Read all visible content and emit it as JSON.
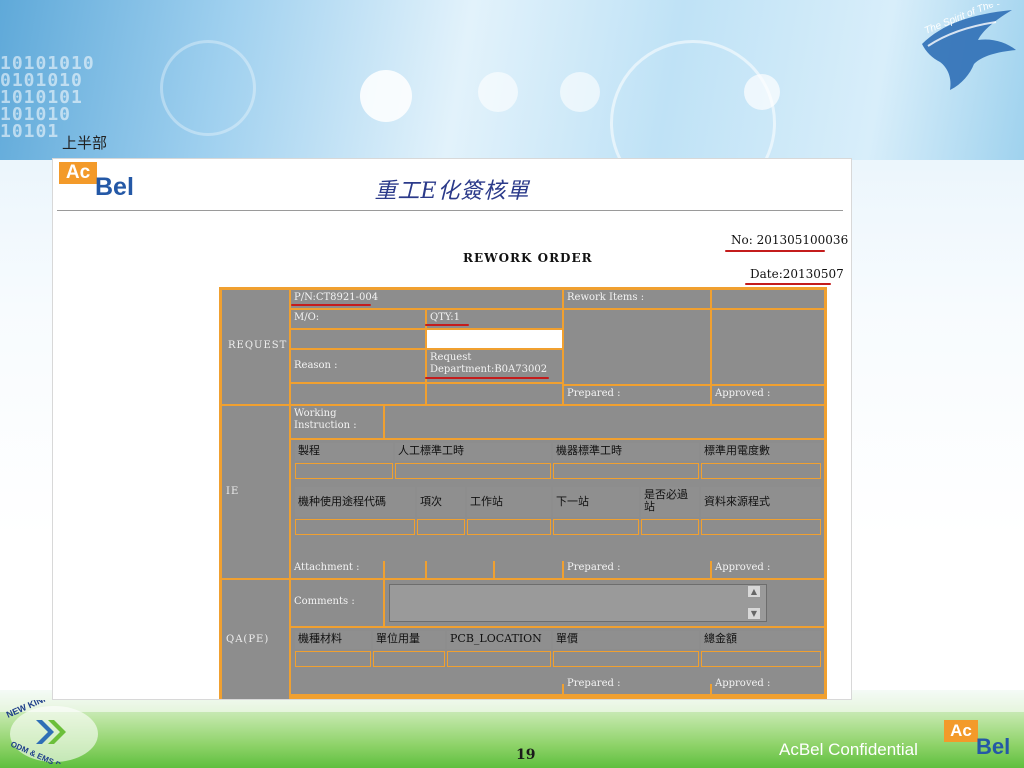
{
  "slide": {
    "caption": "上半部",
    "page_number": "19",
    "confidential": "AcBel Confidential",
    "eagle_tagline": "The Spirit of The Eagle",
    "partner_badge_top": "NEW KINPO VALUE",
    "partner_badge_bottom": "ODM & EMS Partner"
  },
  "logo": {
    "ac": "Ac",
    "bel": "Bel"
  },
  "form": {
    "title": "重工E化簽核單",
    "subtitle": "REWORK ORDER",
    "no": "No: 201305100036",
    "date": "Date:20130507",
    "request": {
      "section": "REQUEST",
      "pn": "P/N:CT8921-004",
      "rework_items": "Rework Items :",
      "mo": "M/O:",
      "qty": "QTY:1",
      "reason": "Reason :",
      "request_department": "Request Department:B0A73002",
      "prepared": "Prepared :",
      "approved": "Approved :"
    },
    "ie": {
      "section": "IE",
      "working_instruction": "Working Instruction :",
      "headers1": [
        "製程",
        "人工標準工時",
        "機器標準工時",
        "標準用電度數"
      ],
      "headers2": [
        "機种使用途程代碼",
        "項次",
        "工作站",
        "下一站",
        "是否必過站",
        "資料來源程式"
      ],
      "attachment": "Attachment :",
      "prepared": "Prepared :",
      "approved": "Approved :"
    },
    "qa": {
      "section": "QA(PE)",
      "comments": "Comments :",
      "headers": [
        "機種材料",
        "單位用量",
        "PCB_LOCATION",
        "單價",
        "總金額"
      ],
      "prepared": "Prepared :",
      "approved": "Approved :"
    }
  },
  "colors": {
    "form_border": "#f0a030",
    "cell_gray": "#8d8d8d",
    "annotation_red": "#c41c1c",
    "title_blue": "#2b3a8a"
  }
}
